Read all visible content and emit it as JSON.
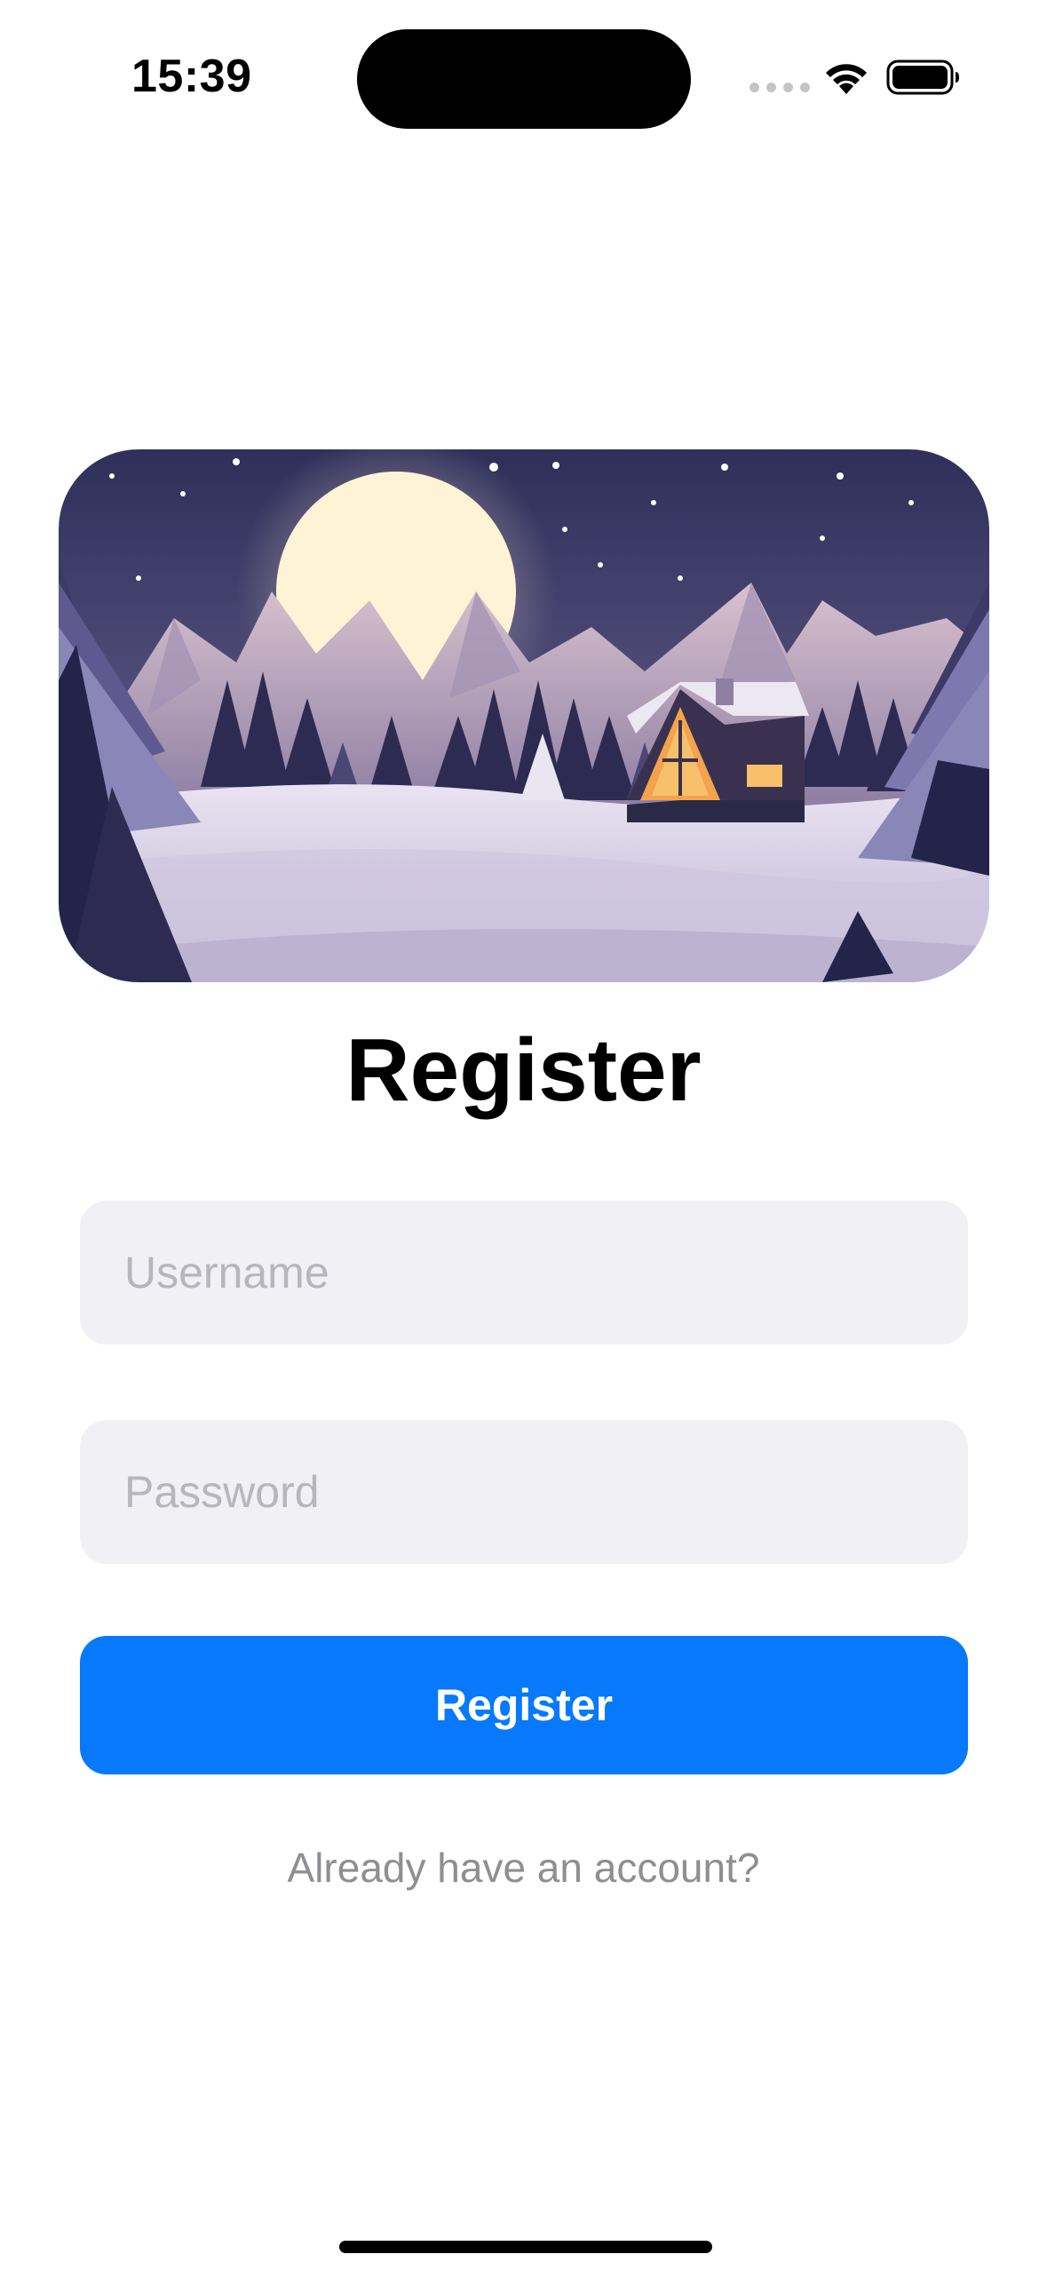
{
  "status_bar": {
    "time": "15:39"
  },
  "hero": {
    "image_icon": "winter-cabin-illustration"
  },
  "page": {
    "title": "Register"
  },
  "form": {
    "username_placeholder": "Username",
    "username_value": "",
    "password_placeholder": "Password",
    "password_value": "",
    "submit_label": "Register"
  },
  "footer": {
    "login_link": "Already have an account?"
  },
  "colors": {
    "accent": "#0879fb",
    "field_background": "#f1f0f5",
    "placeholder": "#b7b6bc",
    "link_text": "#8e8e93"
  }
}
